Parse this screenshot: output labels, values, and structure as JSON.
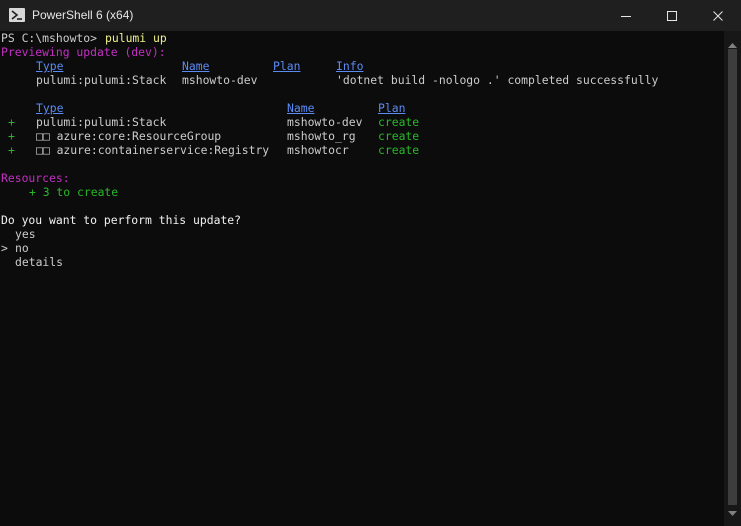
{
  "window": {
    "title": "PowerShell 6 (x64)",
    "icon": "powershell-icon",
    "controls": [
      "minimize-icon",
      "maximize-icon",
      "close-icon"
    ]
  },
  "colors": {
    "background": "#0c0c0c",
    "titlebar": "#1f1f1f",
    "text": "#cccccc",
    "header": "#5b8bf3",
    "magenta": "#c230c2",
    "green": "#2ab62a",
    "command": "#f0f08c"
  },
  "terminal": {
    "prompt": "PS C:\\mshowto> ",
    "command": "pulumi up",
    "preview_line": "Previewing update (dev):",
    "preview_table": {
      "headers": [
        "Type",
        "Name",
        "Plan",
        "Info"
      ],
      "row": [
        "pulumi:pulumi:Stack",
        "mshowto-dev",
        "",
        "'dotnet build -nologo .' completed successfully"
      ]
    },
    "resource_table": {
      "headers": [
        "Type",
        "Name",
        "Plan"
      ],
      "rows": [
        {
          "marker": "+",
          "type": "pulumi:pulumi:Stack",
          "name": "mshowto-dev",
          "plan": "create"
        },
        {
          "marker": "+",
          "type": "□□ azure:core:ResourceGroup",
          "name": "mshowto_rg",
          "plan": "create"
        },
        {
          "marker": "+",
          "type": "□□ azure:containerservice:Registry",
          "name": "mshowtocr",
          "plan": "create"
        }
      ]
    },
    "resources_label": "Resources:",
    "resources_summary": "+ 3 to create",
    "question": "Do you want to perform this update?",
    "selector": ">",
    "options": [
      "yes",
      "no",
      "details"
    ]
  }
}
